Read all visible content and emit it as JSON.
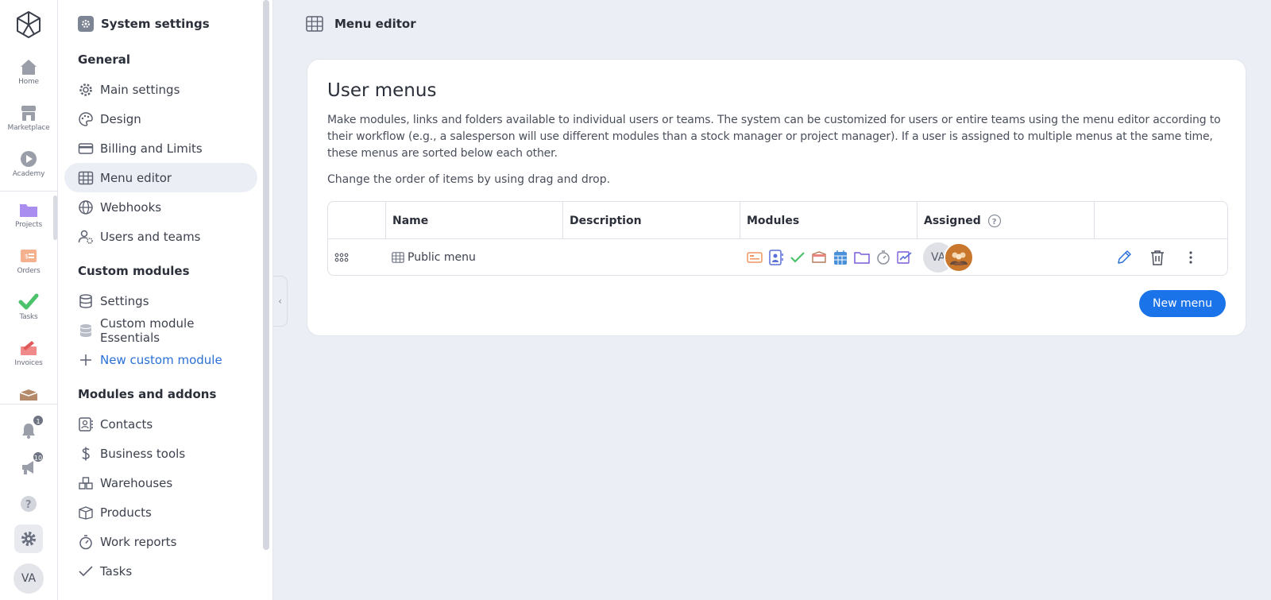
{
  "rail": {
    "items": [
      {
        "label": "Home",
        "icon": "home-icon"
      },
      {
        "label": "Marketplace",
        "icon": "store-icon"
      },
      {
        "label": "Academy",
        "icon": "play-icon"
      },
      {
        "label": "Projects",
        "icon": "folder-icon"
      },
      {
        "label": "Orders",
        "icon": "orders-icon"
      },
      {
        "label": "Tasks",
        "icon": "checkmark-icon"
      },
      {
        "label": "Invoices",
        "icon": "invoice-icon"
      }
    ],
    "notifications_count": "1",
    "announcements_count": "10",
    "avatar_initials": "VA"
  },
  "settings_nav": {
    "title": "System settings",
    "sections": [
      {
        "label": "General"
      },
      {
        "label": "Custom modules"
      },
      {
        "label": "Modules and addons"
      }
    ],
    "general": [
      {
        "label": "Main settings",
        "icon": "gear-icon"
      },
      {
        "label": "Design",
        "icon": "palette-icon"
      },
      {
        "label": "Billing and Limits",
        "icon": "credit-card-icon"
      },
      {
        "label": "Menu editor",
        "icon": "grid-icon"
      },
      {
        "label": "Webhooks",
        "icon": "globe-icon"
      },
      {
        "label": "Users and teams",
        "icon": "users-gear-icon"
      }
    ],
    "custom": [
      {
        "label": "Settings",
        "icon": "database-icon"
      },
      {
        "label": "Custom module Essentials",
        "icon": "database-filled-icon"
      },
      {
        "label": "New custom module",
        "icon": "plus-icon"
      }
    ],
    "addons": [
      {
        "label": "Contacts",
        "icon": "contacts-icon"
      },
      {
        "label": "Business tools",
        "icon": "dollar-icon"
      },
      {
        "label": "Warehouses",
        "icon": "warehouse-icon"
      },
      {
        "label": "Products",
        "icon": "box-icon"
      },
      {
        "label": "Work reports",
        "icon": "stopwatch-icon"
      },
      {
        "label": "Tasks",
        "icon": "check-icon"
      }
    ]
  },
  "topbar": {
    "title": "Menu editor"
  },
  "card": {
    "title": "User menus",
    "description": "Make modules, links and folders available to individual users or teams. The system can be customized for users or entire teams using the menu editor according to their workflow (e.g., a salesperson will use different modules than a stock manager or project manager). If a user is assigned to multiple menus at the same time, these menus are sorted below each other.",
    "hint": "Change the order of items by using drag and drop.",
    "columns": {
      "name": "Name",
      "description": "Description",
      "modules": "Modules",
      "assigned": "Assigned"
    },
    "rows": [
      {
        "name": "Public menu",
        "description": "",
        "assigned_initials": "VA"
      }
    ],
    "new_menu_label": "New menu"
  },
  "colors": {
    "accent": "#1a73e8",
    "link": "#2a6fd6",
    "active_bg": "#eceef5"
  }
}
